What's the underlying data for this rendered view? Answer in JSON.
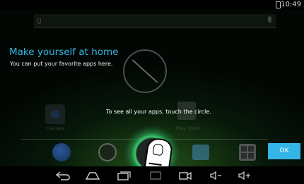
{
  "status_bar": {
    "time": "10:49",
    "battery_icon": "battery-icon"
  },
  "search": {
    "google_glyph": "g",
    "mic_icon": "mic-icon"
  },
  "cling": {
    "title": "Make yourself at home",
    "body": "You can put your favorite apps here.",
    "hint": "To see all your apps, touch the circle.",
    "ok_label": "OK",
    "accent_color": "#33b5e5"
  },
  "home_apps": [
    {
      "label": "Camera",
      "icon": "camera-icon"
    },
    {
      "label": "Play Store",
      "icon": "play-store-icon"
    }
  ],
  "dock": [
    {
      "icon": "browser-icon"
    },
    {
      "icon": "clock-icon"
    },
    {
      "icon": "all-apps-icon"
    },
    {
      "icon": "gallery-icon"
    },
    {
      "icon": "calculator-icon"
    }
  ],
  "nav_bar": [
    {
      "icon": "back-icon"
    },
    {
      "icon": "home-icon"
    },
    {
      "icon": "recent-apps-icon"
    },
    {
      "icon": "screenshot-icon"
    },
    {
      "icon": "video-record-icon"
    },
    {
      "icon": "volume-down-icon"
    },
    {
      "icon": "volume-up-icon"
    }
  ]
}
